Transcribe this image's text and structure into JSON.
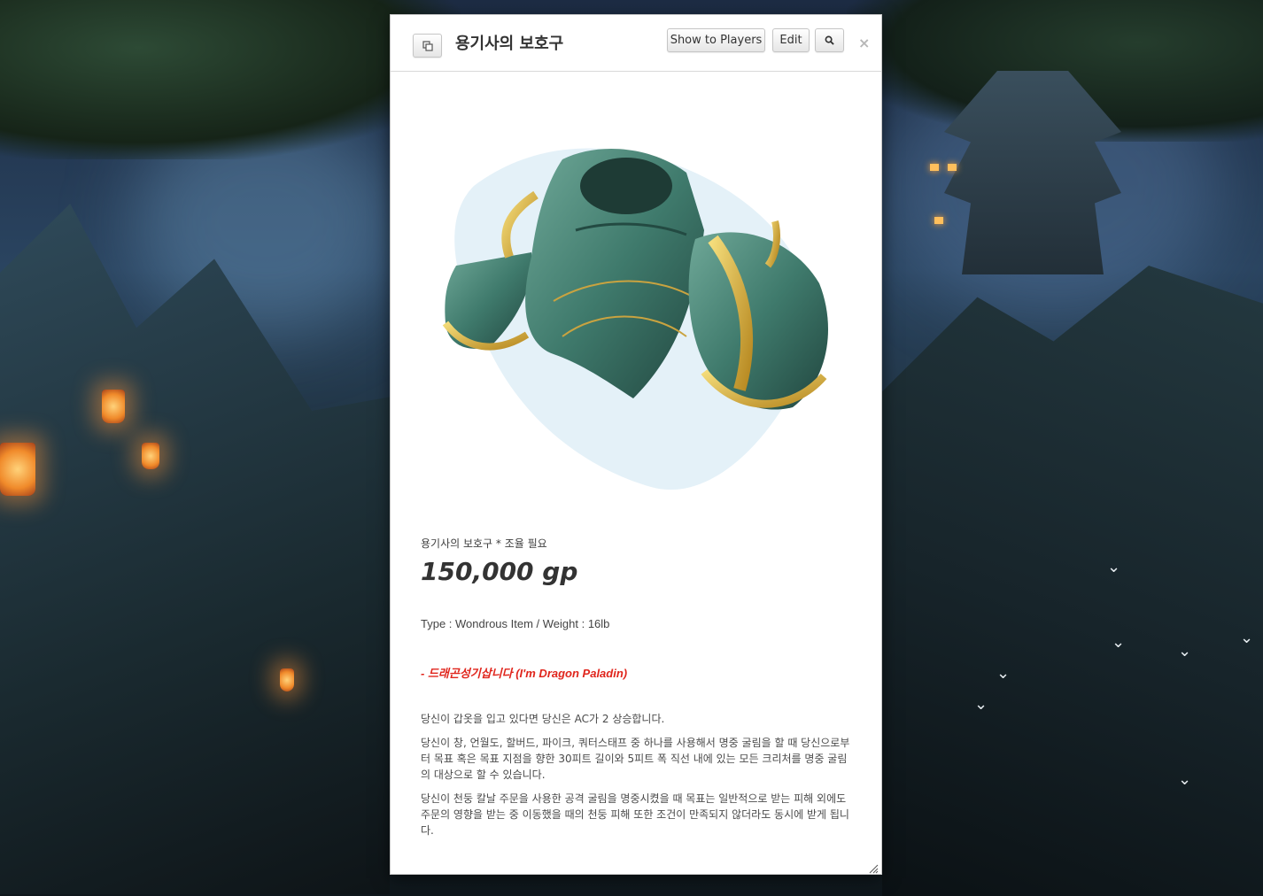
{
  "window": {
    "title": "용기사의 보호구",
    "buttons": {
      "popout_icon": "popout-icon",
      "show_to_players": "Show to Players",
      "edit": "Edit",
      "search_icon": "search-icon",
      "close": "×"
    }
  },
  "item": {
    "subtitle": "용기사의 보호구 * 조율 필요",
    "price": "150,000 gp",
    "type_line": "Type : Wondrous Item / Weight : 16lb",
    "tagline": "- 드래곤성기삽니다 (I'm Dragon Paladin)",
    "paragraphs": [
      "당신이 갑옷을 입고 있다면 당신은 AC가 2 상승합니다.",
      "당신이 창, 언월도, 할버드, 파이크, 쿼터스태프 중 하나를 사용해서 명중 굴림을 할 때 당신으로부터 목표 혹은 목표 지점을 향한 30피트 길이와 5피트 폭 직선 내에 있는 모든 크리처를 명중 굴림의 대상으로 할 수 있습니다.",
      "당신이 천둥 칼날 주문을 사용한 공격 굴림을 명중시켰을 때 목표는 일반적으로 받는 피해 외에도 주문의 영향을 받는 중 이동했을 때의 천둥 피해 또한 조건이 만족되지 않더라도 동시에 받게 됩니다."
    ]
  },
  "colors": {
    "tagline_red": "#e0251c",
    "armor_green": "#3f7a6c",
    "gold_trim": "#d9b43a"
  }
}
